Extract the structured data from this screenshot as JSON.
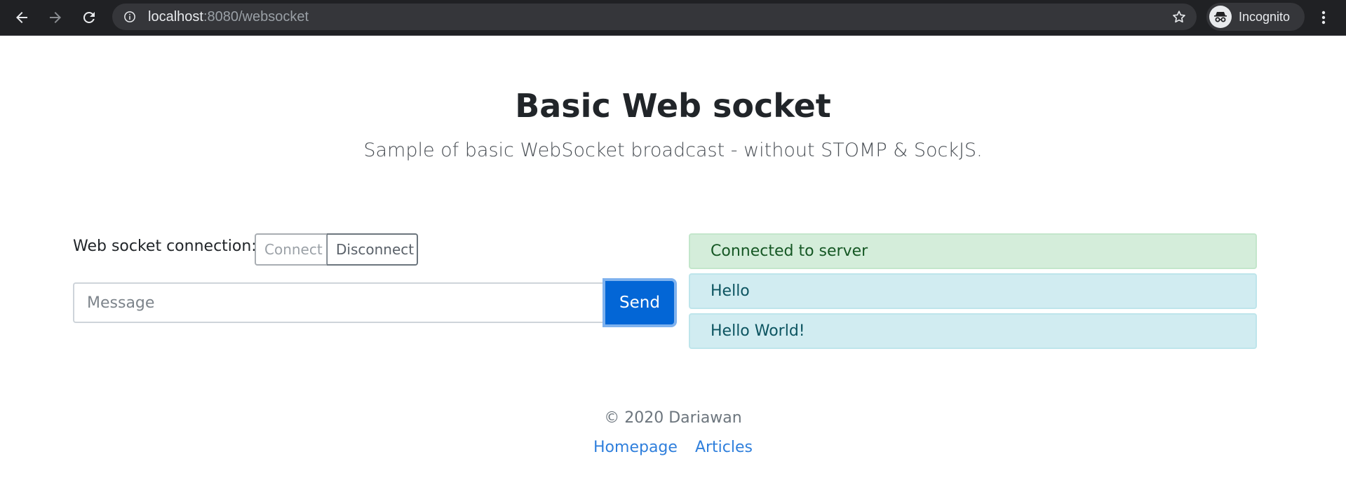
{
  "browser": {
    "url_host": "localhost",
    "url_rest": ":8080/websocket",
    "profile_label": "Incognito",
    "icons": {
      "back": "arrow-left-icon",
      "forward": "arrow-right-icon",
      "reload": "reload-icon",
      "info": "info-icon",
      "bookmark": "star-icon",
      "profile": "incognito-icon",
      "menu": "kebab-menu-icon"
    }
  },
  "page": {
    "title": "Basic Web socket",
    "subtitle": "Sample of basic WebSocket broadcast - without STOMP & SockJS."
  },
  "connection": {
    "label": "Web socket connection:",
    "connect_label": "Connect",
    "disconnect_label": "Disconnect"
  },
  "message_form": {
    "placeholder": "Message",
    "value": "",
    "send_label": "Send"
  },
  "messages": [
    {
      "text": "Connected to server",
      "type": "success"
    },
    {
      "text": "Hello",
      "type": "info"
    },
    {
      "text": "Hello World!",
      "type": "info"
    }
  ],
  "footer": {
    "copyright": "© 2020 Dariawan",
    "links": [
      {
        "label": "Homepage"
      },
      {
        "label": "Articles"
      }
    ]
  },
  "colors": {
    "chrome_bg": "#202124",
    "primary": "#0366d6",
    "success_bg": "#d4edda",
    "info_bg": "#d1ecf1",
    "link": "#2f7fdc"
  }
}
